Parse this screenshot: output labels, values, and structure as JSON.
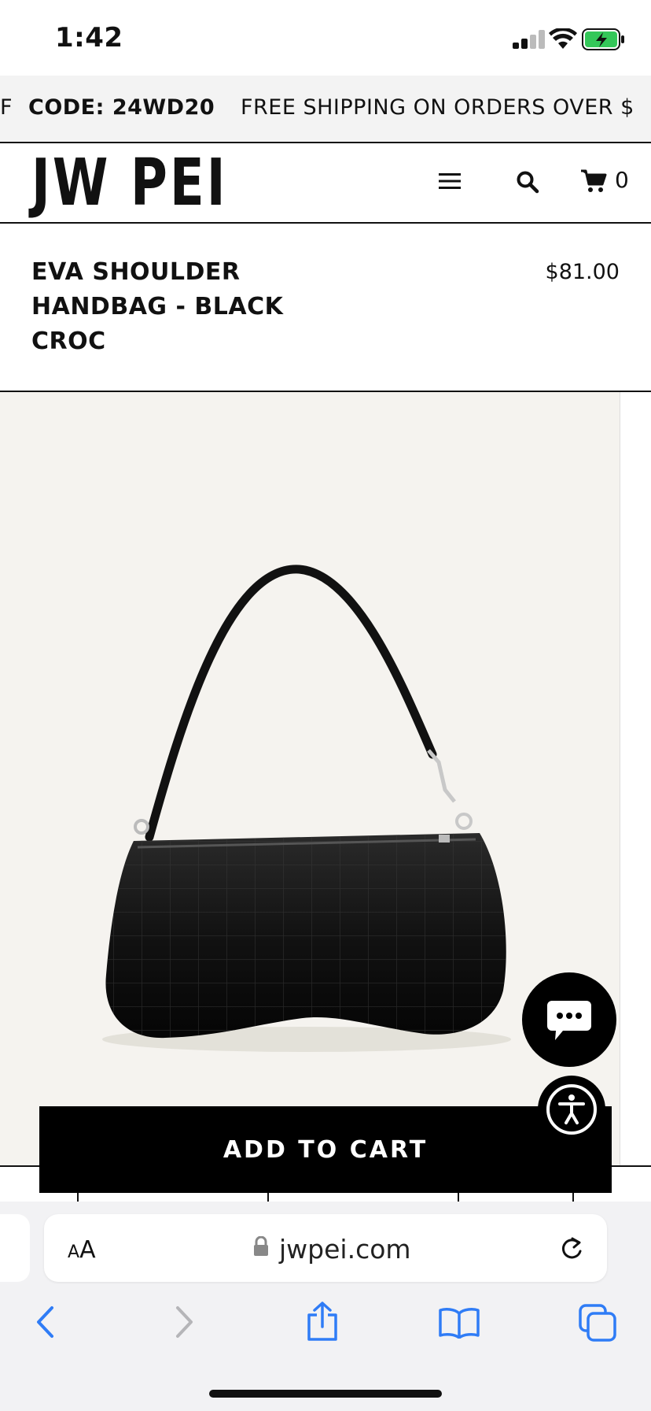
{
  "status_bar": {
    "time": "1:42"
  },
  "promo_bar": {
    "left_fragment": "F",
    "code_text": "CODE: 24WD20",
    "shipping_text": "FREE SHIPPING ON ORDERS OVER $"
  },
  "header": {
    "logo": "JW PEI",
    "cart_count": "0",
    "icons": [
      "menu-icon",
      "search-icon",
      "cart-icon"
    ]
  },
  "product": {
    "title": "EVA SHOULDER\nHANDBAG - BLACK\nCROC",
    "price": "$81.00",
    "image_alt": "Eva shoulder handbag in black croc"
  },
  "buttons": {
    "add_to_cart": "ADD TO CART",
    "chat": "chat-icon",
    "accessibility": "accessibility-icon"
  },
  "browser": {
    "aa_label": "AA",
    "url": "jwpei.com",
    "toolbar_icons": [
      "back-icon",
      "forward-icon",
      "share-icon",
      "bookmarks-icon",
      "tabs-icon"
    ]
  },
  "colors": {
    "accent": "#000000",
    "safari_blue": "#2f7cf6",
    "battery_green": "#34c759",
    "image_bg": "#f5f3ef"
  }
}
